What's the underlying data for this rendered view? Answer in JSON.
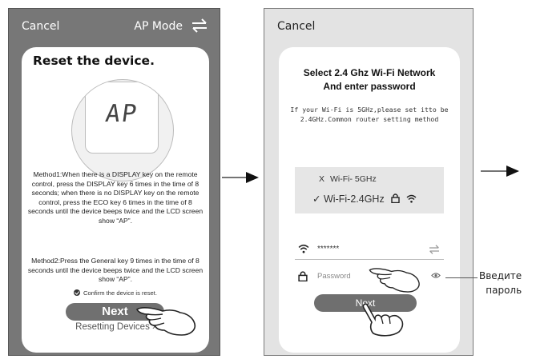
{
  "screen1": {
    "cancel": "Cancel",
    "mode": "AP Mode",
    "title": "Reset the device.",
    "lcd_text": "AP",
    "method1": "Method1:When there is a DISPLAY key on the remote control, press the DISPLAY key 6 times in the time of 8 seconds; when there is no DISPLAY key on the remote control, press the ECO key 6 times in the time of 8 seconds until the device beeps twice and the LCD screen show “AP”.",
    "method2": "Method2:Press the General key 9 times in the time of 8 seconds until the device beeps twice and the LCD screen show “AP”.",
    "confirm": "Confirm the device is reset.",
    "next": "Next",
    "resetting": "Resetting Devices ›"
  },
  "screen2": {
    "cancel": "Cancel",
    "title_line1": "Select 2.4 Ghz Wi-Fi Network",
    "title_line2": "And enter password",
    "intro_line1": "If your Wi-Fi is 5GHz,please set itto be",
    "intro_line2": "2.4GHz.Common router setting method",
    "wifi_5g_mark": "X",
    "wifi_5g": "Wi-Fi- 5GHz",
    "wifi_24_mark": "✓",
    "wifi_24": "Wi-Fi-2.4GHz",
    "ssid_value": "*******",
    "password_placeholder": "Password",
    "next": "Next"
  },
  "annotation": {
    "line1": "Введите",
    "line2": "пароль"
  },
  "colors": {
    "screen1_bg": "#777777",
    "screen2_bg": "#e3e3e3",
    "button": "#707070",
    "card": "#ffffff"
  },
  "icons": [
    "swap-arrows-icon",
    "check-circle-icon",
    "pointing-hand-icon",
    "arrow-right-icon",
    "wifi-icon",
    "lock-icon",
    "eye-icon"
  ]
}
